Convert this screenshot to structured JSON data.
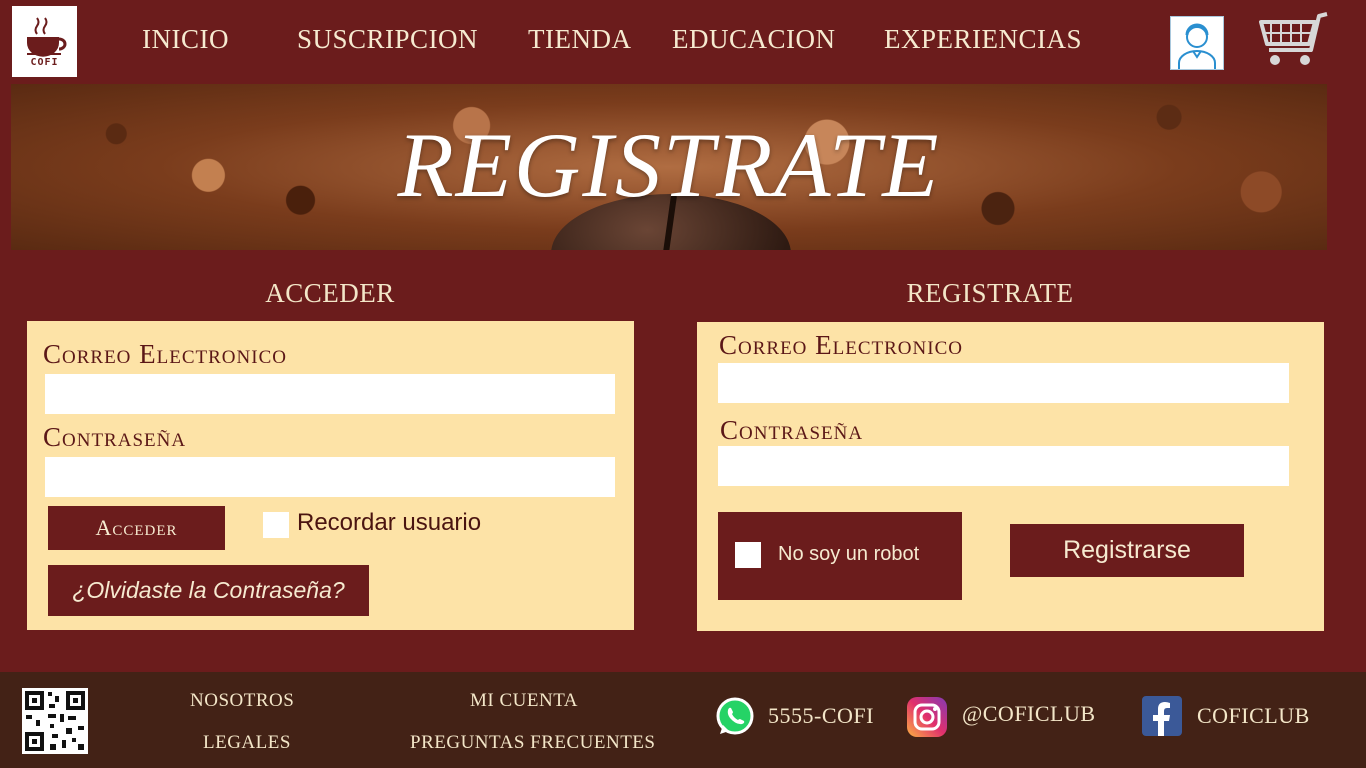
{
  "brand": {
    "logo_text": "COFI"
  },
  "nav": {
    "items": [
      {
        "label": "INICIO"
      },
      {
        "label": "SUSCRIPCION"
      },
      {
        "label": "TIENDA"
      },
      {
        "label": "EDUCACION"
      },
      {
        "label": "EXPERIENCIAS"
      }
    ]
  },
  "banner": {
    "title": "REGISTRATE"
  },
  "login": {
    "title": "ACCEDER",
    "email_label": "Correo Electronico",
    "email_value": "",
    "password_label": "Contraseña",
    "password_value": "",
    "submit_label": "Acceder",
    "remember_label": "Recordar usuario",
    "forgot_label": "¿Olvidaste la Contraseña?"
  },
  "register": {
    "title": "REGISTRATE",
    "email_label": "Correo Electronico",
    "email_value": "",
    "password_label": "Contraseña",
    "password_value": "",
    "captcha_label": "No soy un robot",
    "submit_label": "Registrarse"
  },
  "footer": {
    "links": {
      "nosotros": "NOSOTROS",
      "legales": "LEGALES",
      "mi_cuenta": "MI CUENTA",
      "faq": "PREGUNTAS FRECUENTES"
    },
    "whatsapp": "5555-COFI",
    "instagram": "@COFICLUB",
    "facebook": "COFICLUB"
  },
  "colors": {
    "background": "#6b1c1c",
    "panel": "#fde3a7",
    "footer": "#432216",
    "button": "#6b1c1c"
  }
}
